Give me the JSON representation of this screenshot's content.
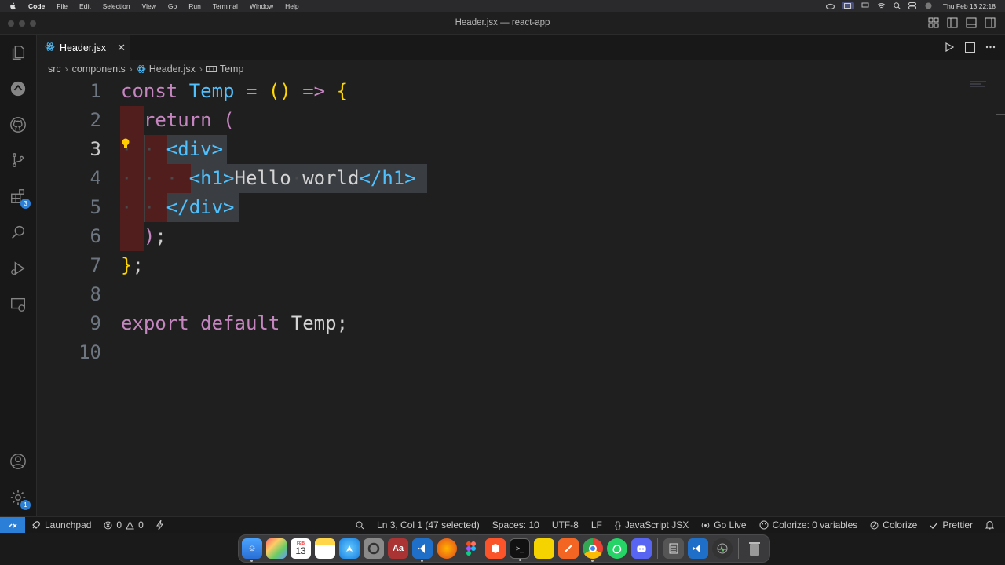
{
  "menubar": {
    "items": [
      "Code",
      "File",
      "Edit",
      "Selection",
      "View",
      "Go",
      "Run",
      "Terminal",
      "Window",
      "Help"
    ],
    "clock": "Thu Feb 13  22:18"
  },
  "window": {
    "title": "Header.jsx — react-app"
  },
  "tab": {
    "label": "Header.jsx",
    "close": "✕"
  },
  "breadcrumb": {
    "parts": [
      "src",
      "components",
      "Header.jsx",
      "Temp"
    ]
  },
  "activity": {
    "extensions_badge": "3",
    "settings_badge": "1"
  },
  "editor": {
    "lines": [
      {
        "num": "1"
      },
      {
        "num": "2"
      },
      {
        "num": "3"
      },
      {
        "num": "4"
      },
      {
        "num": "5"
      },
      {
        "num": "6"
      },
      {
        "num": "7"
      },
      {
        "num": "8"
      },
      {
        "num": "9"
      },
      {
        "num": "10"
      }
    ],
    "tokens": {
      "const": "const",
      "temp": "Temp",
      "eq": "=",
      "parens": "()",
      "arrow": "=>",
      "lbrace": "{",
      "return": "return",
      "lparen": "(",
      "div_open": "<div>",
      "h1_open": "<h1>",
      "hello": "Hello",
      "world": "world",
      "h1_close": "</h1>",
      "div_close": "</div>",
      "rparen": ")",
      "semi": ";",
      "rbrace": "}",
      "export": "export",
      "default": "default",
      "temp_ref": "Temp"
    }
  },
  "statusbar": {
    "launchpad": "Launchpad",
    "errors": "0",
    "warnings": "0",
    "position": "Ln 3, Col 1 (47 selected)",
    "spaces": "Spaces: 10",
    "encoding": "UTF-8",
    "eol": "LF",
    "language": "JavaScript JSX",
    "golive": "Go Live",
    "colorize_vars": "Colorize: 0 variables",
    "colorize": "Colorize",
    "prettier": "Prettier"
  },
  "dock": {
    "calendar_month": "FEB",
    "calendar_day": "13",
    "dictionary": "Aa"
  },
  "colors": {
    "accent": "#2c7fd6",
    "keyword": "#c586c0",
    "function": "#4fc1ff",
    "bracket": "#ffd700",
    "tag": "#569cd6"
  }
}
